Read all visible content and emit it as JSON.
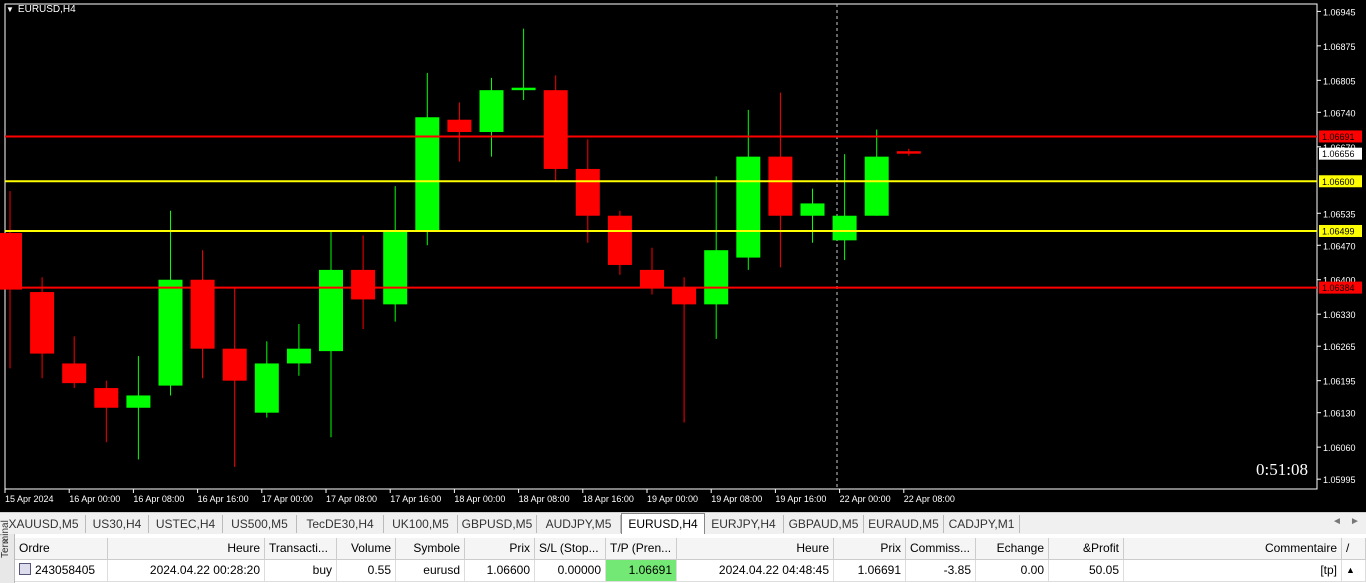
{
  "chart": {
    "symbol_label": "EURUSD,H4",
    "countdown": "0:51:08",
    "price_axis": [
      "1.06945",
      "1.06875",
      "1.06805",
      "1.06740",
      "1.06670",
      "1.06535",
      "1.06470",
      "1.06400",
      "1.06330",
      "1.06265",
      "1.06195",
      "1.06130",
      "1.06060",
      "1.05995"
    ],
    "time_axis": [
      "15 Apr 2024",
      "16 Apr 00:00",
      "16 Apr 08:00",
      "16 Apr 16:00",
      "17 Apr 00:00",
      "17 Apr 08:00",
      "17 Apr 16:00",
      "18 Apr 00:00",
      "18 Apr 08:00",
      "18 Apr 16:00",
      "19 Apr 00:00",
      "19 Apr 08:00",
      "19 Apr 16:00",
      "22 Apr 00:00",
      "22 Apr 08:00"
    ],
    "levels": [
      {
        "price": 1.06691,
        "label": "1.06691",
        "color": "#ff0000"
      },
      {
        "price": 1.06656,
        "label": "1.06656",
        "color": "#ffffff"
      },
      {
        "price": 1.066,
        "label": "1.06600",
        "color": "#ffff00"
      },
      {
        "price": 1.06499,
        "label": "1.06499",
        "color": "#ffff00"
      },
      {
        "price": 1.06384,
        "label": "1.06384",
        "color": "#ff0000"
      }
    ],
    "colors": {
      "bull": "#00ff00",
      "bear": "#ff0000",
      "background": "#000000"
    }
  },
  "chart_data": {
    "type": "candlestick",
    "title": "EURUSD,H4",
    "ylim": [
      1.05995,
      1.0696
    ],
    "candles": [
      {
        "o": 1.06495,
        "h": 1.0658,
        "l": 1.0622,
        "c": 1.0638
      },
      {
        "o": 1.06375,
        "h": 1.06405,
        "l": 1.062,
        "c": 1.0625
      },
      {
        "o": 1.0623,
        "h": 1.06285,
        "l": 1.0618,
        "c": 1.0619
      },
      {
        "o": 1.0618,
        "h": 1.06195,
        "l": 1.0607,
        "c": 1.0614
      },
      {
        "o": 1.0614,
        "h": 1.06245,
        "l": 1.06035,
        "c": 1.06165
      },
      {
        "o": 1.06185,
        "h": 1.0654,
        "l": 1.06165,
        "c": 1.064
      },
      {
        "o": 1.064,
        "h": 1.0646,
        "l": 1.062,
        "c": 1.0626
      },
      {
        "o": 1.0626,
        "h": 1.06385,
        "l": 1.0602,
        "c": 1.06195
      },
      {
        "o": 1.0613,
        "h": 1.06275,
        "l": 1.0612,
        "c": 1.0623
      },
      {
        "o": 1.0623,
        "h": 1.0631,
        "l": 1.06205,
        "c": 1.0626
      },
      {
        "o": 1.06255,
        "h": 1.065,
        "l": 1.0608,
        "c": 1.0642
      },
      {
        "o": 1.0642,
        "h": 1.0649,
        "l": 1.063,
        "c": 1.0636
      },
      {
        "o": 1.0635,
        "h": 1.0659,
        "l": 1.06315,
        "c": 1.065
      },
      {
        "o": 1.065,
        "h": 1.0682,
        "l": 1.0647,
        "c": 1.0673
      },
      {
        "o": 1.06725,
        "h": 1.0676,
        "l": 1.0664,
        "c": 1.067
      },
      {
        "o": 1.067,
        "h": 1.0681,
        "l": 1.0665,
        "c": 1.06785
      },
      {
        "o": 1.06785,
        "h": 1.0691,
        "l": 1.06765,
        "c": 1.0679
      },
      {
        "o": 1.06785,
        "h": 1.06815,
        "l": 1.066,
        "c": 1.06625
      },
      {
        "o": 1.06625,
        "h": 1.06685,
        "l": 1.06475,
        "c": 1.0653
      },
      {
        "o": 1.0653,
        "h": 1.0654,
        "l": 1.0641,
        "c": 1.0643
      },
      {
        "o": 1.0642,
        "h": 1.06465,
        "l": 1.0637,
        "c": 1.06385
      },
      {
        "o": 1.06385,
        "h": 1.06405,
        "l": 1.0611,
        "c": 1.0635
      },
      {
        "o": 1.0635,
        "h": 1.0661,
        "l": 1.0628,
        "c": 1.0646
      },
      {
        "o": 1.06445,
        "h": 1.06745,
        "l": 1.0642,
        "c": 1.0665
      },
      {
        "o": 1.0665,
        "h": 1.0678,
        "l": 1.06425,
        "c": 1.0653
      },
      {
        "o": 1.0653,
        "h": 1.06585,
        "l": 1.06475,
        "c": 1.06555
      },
      {
        "o": 1.0648,
        "h": 1.06655,
        "l": 1.0644,
        "c": 1.0653
      },
      {
        "o": 1.0653,
        "h": 1.06705,
        "l": 1.0653,
        "c": 1.0665
      },
      {
        "o": 1.06661,
        "h": 1.06666,
        "l": 1.06652,
        "c": 1.06656
      }
    ]
  },
  "tabs": {
    "items": [
      "XAUUSD,M5",
      "US30,H4",
      "USTEC,H4",
      "US500,M5",
      "TecDE30,H4",
      "UK100,M5",
      "GBPUSD,M5",
      "AUDJPY,M5",
      "EURUSD,H4",
      "EURJPY,H4",
      "GBPAUD,M5",
      "EURAUD,M5",
      "CADJPY,M1"
    ],
    "active_index": 8,
    "nav_left": "◄",
    "nav_right": "►"
  },
  "terminal": {
    "side_label": "Terminal",
    "close": "×",
    "headers": [
      "Ordre",
      "Heure",
      "Transacti...",
      "Volume",
      "Symbole",
      "Prix",
      "S/L (Stop...",
      "T/P (Pren...",
      "Heure",
      "Prix",
      "Commiss...",
      "Echange",
      "&Profit",
      "Commentaire",
      "/"
    ],
    "row": [
      "243058405",
      "2024.04.22 00:28:20",
      "buy",
      "0.55",
      "eurusd",
      "1.06600",
      "0.00000",
      "1.06691",
      "2024.04.22 04:48:45",
      "1.06691",
      "-3.85",
      "0.00",
      "50.05",
      "[tp]"
    ],
    "scroll_up": "▲"
  }
}
